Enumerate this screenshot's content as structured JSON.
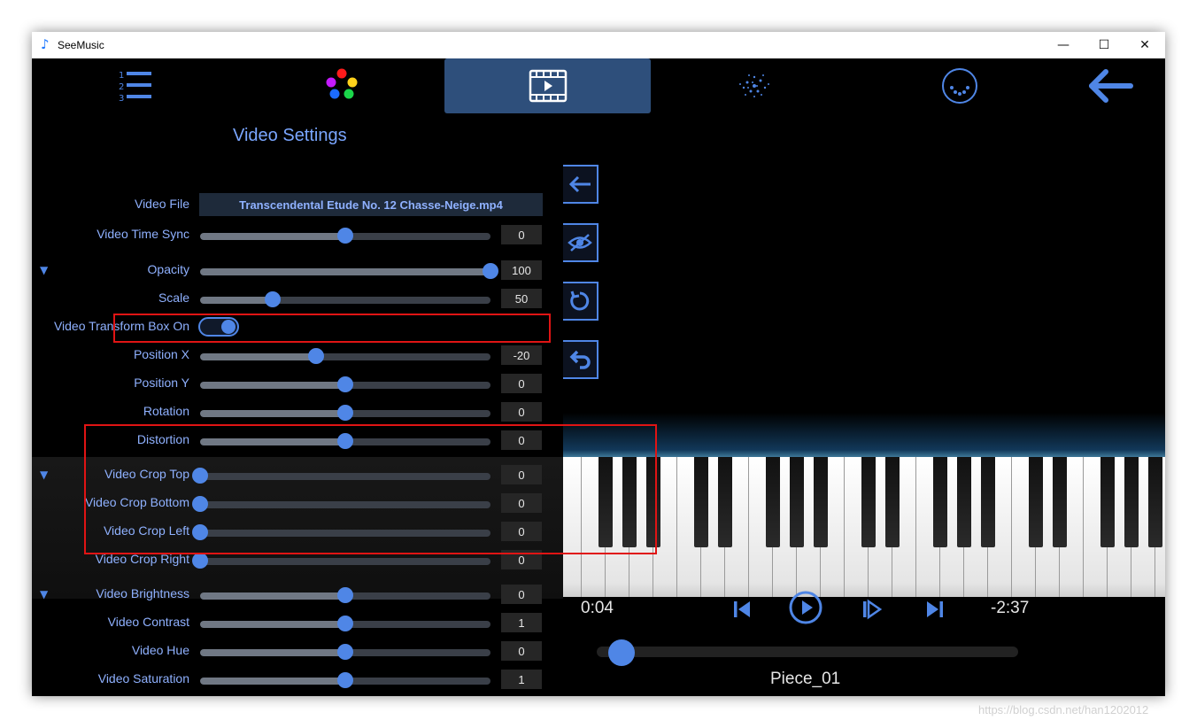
{
  "window": {
    "title": "SeeMusic",
    "minimize": "—",
    "maximize": "☐",
    "close": "✕"
  },
  "nav": {
    "items": [
      {
        "name": "playlist",
        "icon": "numbered-list-icon"
      },
      {
        "name": "colors",
        "icon": "color-dots-icon"
      },
      {
        "name": "video",
        "icon": "film-icon",
        "active": true
      },
      {
        "name": "particles",
        "icon": "particles-icon"
      },
      {
        "name": "more",
        "icon": "more-circle-icon"
      },
      {
        "name": "back",
        "icon": "arrow-left-icon"
      }
    ]
  },
  "settings": {
    "title": "Video Settings",
    "video_file_label": "Video File",
    "video_file_value": "Transcendental Etude No. 12 Chasse-Neige.mp4",
    "transform_box_label": "Video Transform Box On",
    "sliders": [
      {
        "label": "Video Time Sync",
        "value": "0",
        "level": 0.5
      },
      {
        "label": "Opacity",
        "value": "100",
        "level": 1.0
      },
      {
        "label": "Scale",
        "value": "50",
        "level": 0.25
      },
      {
        "label": "Position X",
        "value": "-20",
        "level": 0.4
      },
      {
        "label": "Position Y",
        "value": "0",
        "level": 0.5
      },
      {
        "label": "Rotation",
        "value": "0",
        "level": 0.5
      },
      {
        "label": "Distortion",
        "value": "0",
        "level": 0.5
      },
      {
        "label": "Video Crop Top",
        "value": "0",
        "level": 0.0
      },
      {
        "label": "Video Crop Bottom",
        "value": "0",
        "level": 0.0
      },
      {
        "label": "Video Crop Left",
        "value": "0",
        "level": 0.0
      },
      {
        "label": "Video Crop Right",
        "value": "0",
        "level": 0.0
      },
      {
        "label": "Video Brightness",
        "value": "0",
        "level": 0.5
      },
      {
        "label": "Video Contrast",
        "value": "1",
        "level": 0.5
      },
      {
        "label": "Video Hue",
        "value": "0",
        "level": 0.5
      },
      {
        "label": "Video Saturation",
        "value": "1",
        "level": 0.5
      }
    ],
    "section_toggle": "▼"
  },
  "side_buttons": [
    "arrow-left-icon",
    "eye-off-icon",
    "reset-icon",
    "undo-icon"
  ],
  "player": {
    "elapsed": "0:04",
    "remaining": "-2:37",
    "piece_name": "Piece_01",
    "progress": 0.03
  },
  "watermark": "https://blog.csdn.net/han1202012",
  "colors": {
    "accent": "#4f86e6",
    "label": "#8fb1ff",
    "highlight": "#e01414"
  }
}
